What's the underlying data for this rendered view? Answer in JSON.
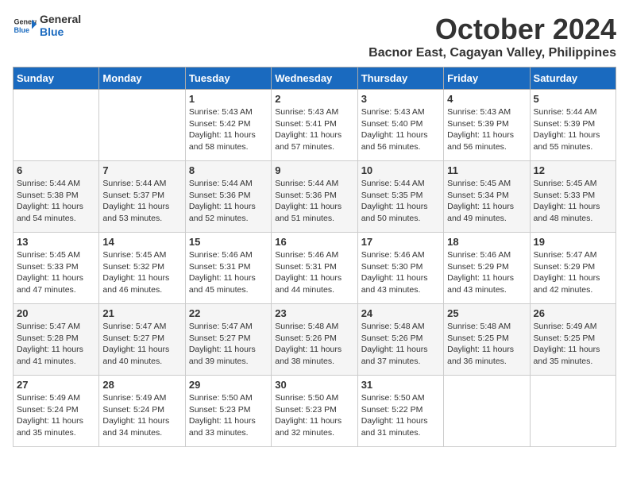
{
  "header": {
    "logo_general": "General",
    "logo_blue": "Blue",
    "month_title": "October 2024",
    "location": "Bacnor East, Cagayan Valley, Philippines"
  },
  "weekdays": [
    "Sunday",
    "Monday",
    "Tuesday",
    "Wednesday",
    "Thursday",
    "Friday",
    "Saturday"
  ],
  "weeks": [
    [
      {
        "day": "",
        "content": ""
      },
      {
        "day": "",
        "content": ""
      },
      {
        "day": "1",
        "content": "Sunrise: 5:43 AM\nSunset: 5:42 PM\nDaylight: 11 hours and 58 minutes."
      },
      {
        "day": "2",
        "content": "Sunrise: 5:43 AM\nSunset: 5:41 PM\nDaylight: 11 hours and 57 minutes."
      },
      {
        "day": "3",
        "content": "Sunrise: 5:43 AM\nSunset: 5:40 PM\nDaylight: 11 hours and 56 minutes."
      },
      {
        "day": "4",
        "content": "Sunrise: 5:43 AM\nSunset: 5:39 PM\nDaylight: 11 hours and 56 minutes."
      },
      {
        "day": "5",
        "content": "Sunrise: 5:44 AM\nSunset: 5:39 PM\nDaylight: 11 hours and 55 minutes."
      }
    ],
    [
      {
        "day": "6",
        "content": "Sunrise: 5:44 AM\nSunset: 5:38 PM\nDaylight: 11 hours and 54 minutes."
      },
      {
        "day": "7",
        "content": "Sunrise: 5:44 AM\nSunset: 5:37 PM\nDaylight: 11 hours and 53 minutes."
      },
      {
        "day": "8",
        "content": "Sunrise: 5:44 AM\nSunset: 5:36 PM\nDaylight: 11 hours and 52 minutes."
      },
      {
        "day": "9",
        "content": "Sunrise: 5:44 AM\nSunset: 5:36 PM\nDaylight: 11 hours and 51 minutes."
      },
      {
        "day": "10",
        "content": "Sunrise: 5:44 AM\nSunset: 5:35 PM\nDaylight: 11 hours and 50 minutes."
      },
      {
        "day": "11",
        "content": "Sunrise: 5:45 AM\nSunset: 5:34 PM\nDaylight: 11 hours and 49 minutes."
      },
      {
        "day": "12",
        "content": "Sunrise: 5:45 AM\nSunset: 5:33 PM\nDaylight: 11 hours and 48 minutes."
      }
    ],
    [
      {
        "day": "13",
        "content": "Sunrise: 5:45 AM\nSunset: 5:33 PM\nDaylight: 11 hours and 47 minutes."
      },
      {
        "day": "14",
        "content": "Sunrise: 5:45 AM\nSunset: 5:32 PM\nDaylight: 11 hours and 46 minutes."
      },
      {
        "day": "15",
        "content": "Sunrise: 5:46 AM\nSunset: 5:31 PM\nDaylight: 11 hours and 45 minutes."
      },
      {
        "day": "16",
        "content": "Sunrise: 5:46 AM\nSunset: 5:31 PM\nDaylight: 11 hours and 44 minutes."
      },
      {
        "day": "17",
        "content": "Sunrise: 5:46 AM\nSunset: 5:30 PM\nDaylight: 11 hours and 43 minutes."
      },
      {
        "day": "18",
        "content": "Sunrise: 5:46 AM\nSunset: 5:29 PM\nDaylight: 11 hours and 43 minutes."
      },
      {
        "day": "19",
        "content": "Sunrise: 5:47 AM\nSunset: 5:29 PM\nDaylight: 11 hours and 42 minutes."
      }
    ],
    [
      {
        "day": "20",
        "content": "Sunrise: 5:47 AM\nSunset: 5:28 PM\nDaylight: 11 hours and 41 minutes."
      },
      {
        "day": "21",
        "content": "Sunrise: 5:47 AM\nSunset: 5:27 PM\nDaylight: 11 hours and 40 minutes."
      },
      {
        "day": "22",
        "content": "Sunrise: 5:47 AM\nSunset: 5:27 PM\nDaylight: 11 hours and 39 minutes."
      },
      {
        "day": "23",
        "content": "Sunrise: 5:48 AM\nSunset: 5:26 PM\nDaylight: 11 hours and 38 minutes."
      },
      {
        "day": "24",
        "content": "Sunrise: 5:48 AM\nSunset: 5:26 PM\nDaylight: 11 hours and 37 minutes."
      },
      {
        "day": "25",
        "content": "Sunrise: 5:48 AM\nSunset: 5:25 PM\nDaylight: 11 hours and 36 minutes."
      },
      {
        "day": "26",
        "content": "Sunrise: 5:49 AM\nSunset: 5:25 PM\nDaylight: 11 hours and 35 minutes."
      }
    ],
    [
      {
        "day": "27",
        "content": "Sunrise: 5:49 AM\nSunset: 5:24 PM\nDaylight: 11 hours and 35 minutes."
      },
      {
        "day": "28",
        "content": "Sunrise: 5:49 AM\nSunset: 5:24 PM\nDaylight: 11 hours and 34 minutes."
      },
      {
        "day": "29",
        "content": "Sunrise: 5:50 AM\nSunset: 5:23 PM\nDaylight: 11 hours and 33 minutes."
      },
      {
        "day": "30",
        "content": "Sunrise: 5:50 AM\nSunset: 5:23 PM\nDaylight: 11 hours and 32 minutes."
      },
      {
        "day": "31",
        "content": "Sunrise: 5:50 AM\nSunset: 5:22 PM\nDaylight: 11 hours and 31 minutes."
      },
      {
        "day": "",
        "content": ""
      },
      {
        "day": "",
        "content": ""
      }
    ]
  ]
}
